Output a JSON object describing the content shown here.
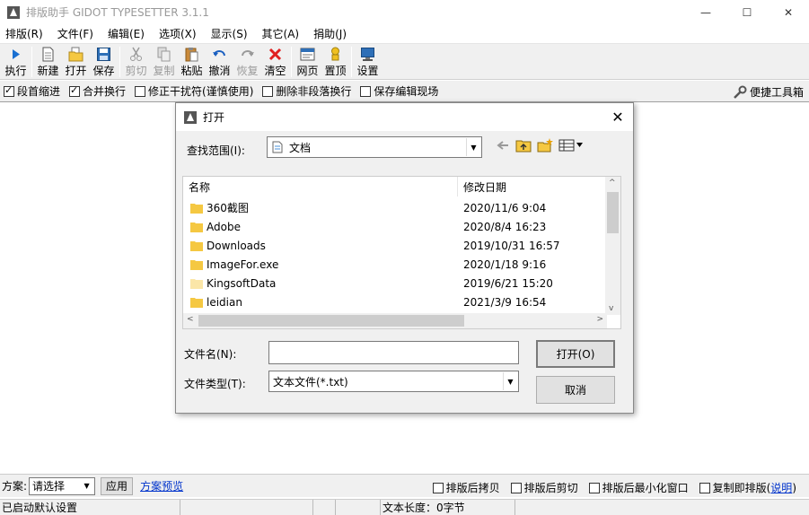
{
  "window": {
    "title": "排版助手 GIDOT TYPESETTER 3.1.1",
    "minimize": "—",
    "maximize": "☐",
    "close": "✕"
  },
  "menu": [
    "排版(R)",
    "文件(F)",
    "编辑(E)",
    "选项(X)",
    "显示(S)",
    "其它(A)",
    "捐助(J)"
  ],
  "toolbar": {
    "run": "执行",
    "new": "新建",
    "open": "打开",
    "save": "保存",
    "cut": "剪切",
    "copy": "复制",
    "paste": "粘贴",
    "undo": "撤消",
    "redo": "恢复",
    "clear": "清空",
    "web": "网页",
    "top": "置顶",
    "settings": "设置"
  },
  "options": {
    "indent": "段首缩进",
    "indent_checked": true,
    "merge": "合并换行",
    "merge_checked": true,
    "fix": "修正干扰符(谨慎使用)",
    "fix_checked": false,
    "delbreak": "删除非段落换行",
    "delbreak_checked": false,
    "keep": "保存编辑现场",
    "keep_checked": false,
    "quick_tools": "便捷工具箱"
  },
  "bottom": {
    "scheme_label": "方案:",
    "scheme_value": "请选择",
    "apply": "应用",
    "preview": "方案预览",
    "copy_after": "排版后拷贝",
    "cut_after": "排版后剪切",
    "minimize_after": "排版后最小化窗口",
    "copy_instant": "复制即排版(",
    "help_link": "说明",
    "help_close": ")"
  },
  "status": {
    "cell1": "已启动默认设置",
    "cell2": "",
    "cell3": "",
    "cell4": "",
    "length": "文本长度：0字节"
  },
  "dialog": {
    "title": "打开",
    "look_in_label": "查找范围(I):",
    "look_in_value": "文档",
    "columns": {
      "name": "名称",
      "date": "修改日期"
    },
    "files": [
      {
        "name": "360截图",
        "date": "2020/11/6 9:04"
      },
      {
        "name": "Adobe",
        "date": "2020/8/4 16:23"
      },
      {
        "name": "Downloads",
        "date": "2019/10/31 16:57"
      },
      {
        "name": "ImageFor.exe",
        "date": "2020/1/18 9:16"
      },
      {
        "name": "KingsoftData",
        "date": "2019/6/21 15:20"
      },
      {
        "name": "leidian",
        "date": "2021/3/9 16:54"
      }
    ],
    "filename_label": "文件名(N):",
    "filename_value": "",
    "filetype_label": "文件类型(T):",
    "filetype_value": "文本文件(*.txt)",
    "open_button": "打开(O)",
    "cancel_button": "取消"
  },
  "colors": {
    "link": "#0033cc",
    "folder": "#f5c842"
  }
}
